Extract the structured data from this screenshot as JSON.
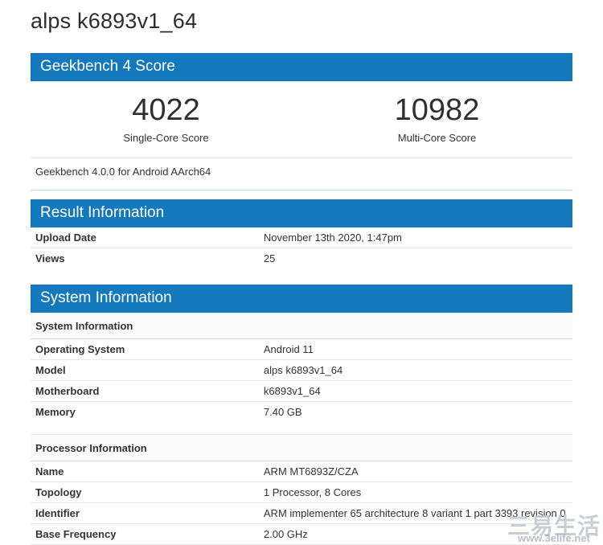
{
  "page": {
    "title": "alps k6893v1_64"
  },
  "colors": {
    "header_blue": "#1478bd",
    "footer_accent": "#b5dcec",
    "row_border": "#e7e7e7"
  },
  "score_panel": {
    "header": "Geekbench 4 Score",
    "scores": [
      {
        "value": "4022",
        "label": "Single-Core Score"
      },
      {
        "value": "10982",
        "label": "Multi-Core Score"
      }
    ],
    "footer": "Geekbench 4.0.0 for Android AArch64"
  },
  "result_info": {
    "header": "Result Information",
    "rows": [
      {
        "label": "Upload Date",
        "value": "November 13th 2020, 1:47pm"
      },
      {
        "label": "Views",
        "value": "25"
      }
    ]
  },
  "system_info": {
    "header": "System Information",
    "groups": [
      {
        "subheader": "System Information",
        "rows": [
          {
            "label": "Operating System",
            "value": "Android 11"
          },
          {
            "label": "Model",
            "value": "alps k6893v1_64"
          },
          {
            "label": "Motherboard",
            "value": "k6893v1_64"
          },
          {
            "label": "Memory",
            "value": "7.40 GB"
          }
        ]
      },
      {
        "subheader": "Processor Information",
        "rows": [
          {
            "label": "Name",
            "value": "ARM MT6893Z/CZA"
          },
          {
            "label": "Topology",
            "value": "1 Processor, 8 Cores"
          },
          {
            "label": "Identifier",
            "value": "ARM implementer 65 architecture 8 variant 1 part 3393 revision 0"
          },
          {
            "label": "Base Frequency",
            "value": "2.00 GHz"
          }
        ]
      }
    ]
  },
  "watermark": {
    "text": "三易生活",
    "url": "www.3elife.net"
  }
}
